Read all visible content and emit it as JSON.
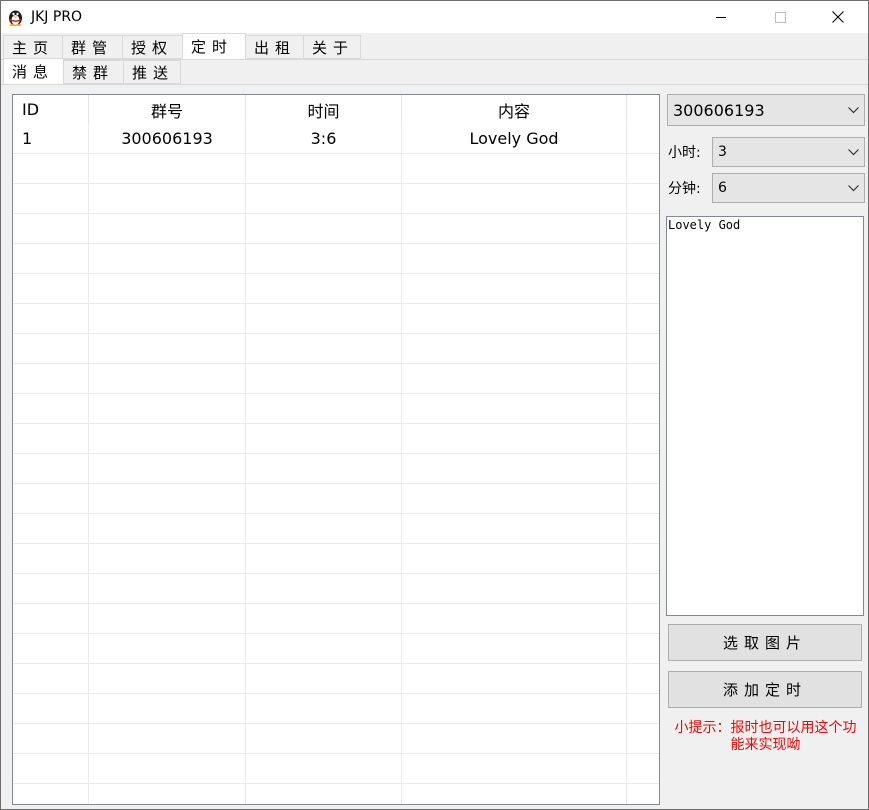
{
  "window": {
    "title": "JKJ PRO",
    "icons": {
      "app": "penguin-icon",
      "minimize": "minimize-icon",
      "maximize": "maximize-icon",
      "close": "close-icon"
    }
  },
  "tabs_row1": [
    {
      "label": "主页",
      "active": false
    },
    {
      "label": "群管",
      "active": false
    },
    {
      "label": "授权",
      "active": false
    },
    {
      "label": "定时",
      "active": true
    },
    {
      "label": "出租",
      "active": false
    },
    {
      "label": "关于",
      "active": false
    }
  ],
  "tabs_row2": [
    {
      "label": "消息",
      "active": true
    },
    {
      "label": "禁群",
      "active": false
    },
    {
      "label": "推送",
      "active": false
    }
  ],
  "grid": {
    "columns": [
      "ID",
      "群号",
      "时间",
      "内容"
    ],
    "rows": [
      [
        "1",
        "300606193",
        "3:6",
        "Lovely God"
      ]
    ],
    "empty_rows": 22
  },
  "panel": {
    "group_value": "300606193",
    "hour_label": "小时:",
    "hour_value": "3",
    "minute_label": "分钟:",
    "minute_value": "6",
    "message_text": "Lovely God",
    "select_image_button": "选取图片",
    "add_timer_button": "添加定时",
    "hint": "小提示：报时也可以用这个功能来实现呦"
  },
  "colors": {
    "hint": "#ff0000",
    "button_bg": "#e1e1e1",
    "window_bg": "#f0f0f0"
  }
}
